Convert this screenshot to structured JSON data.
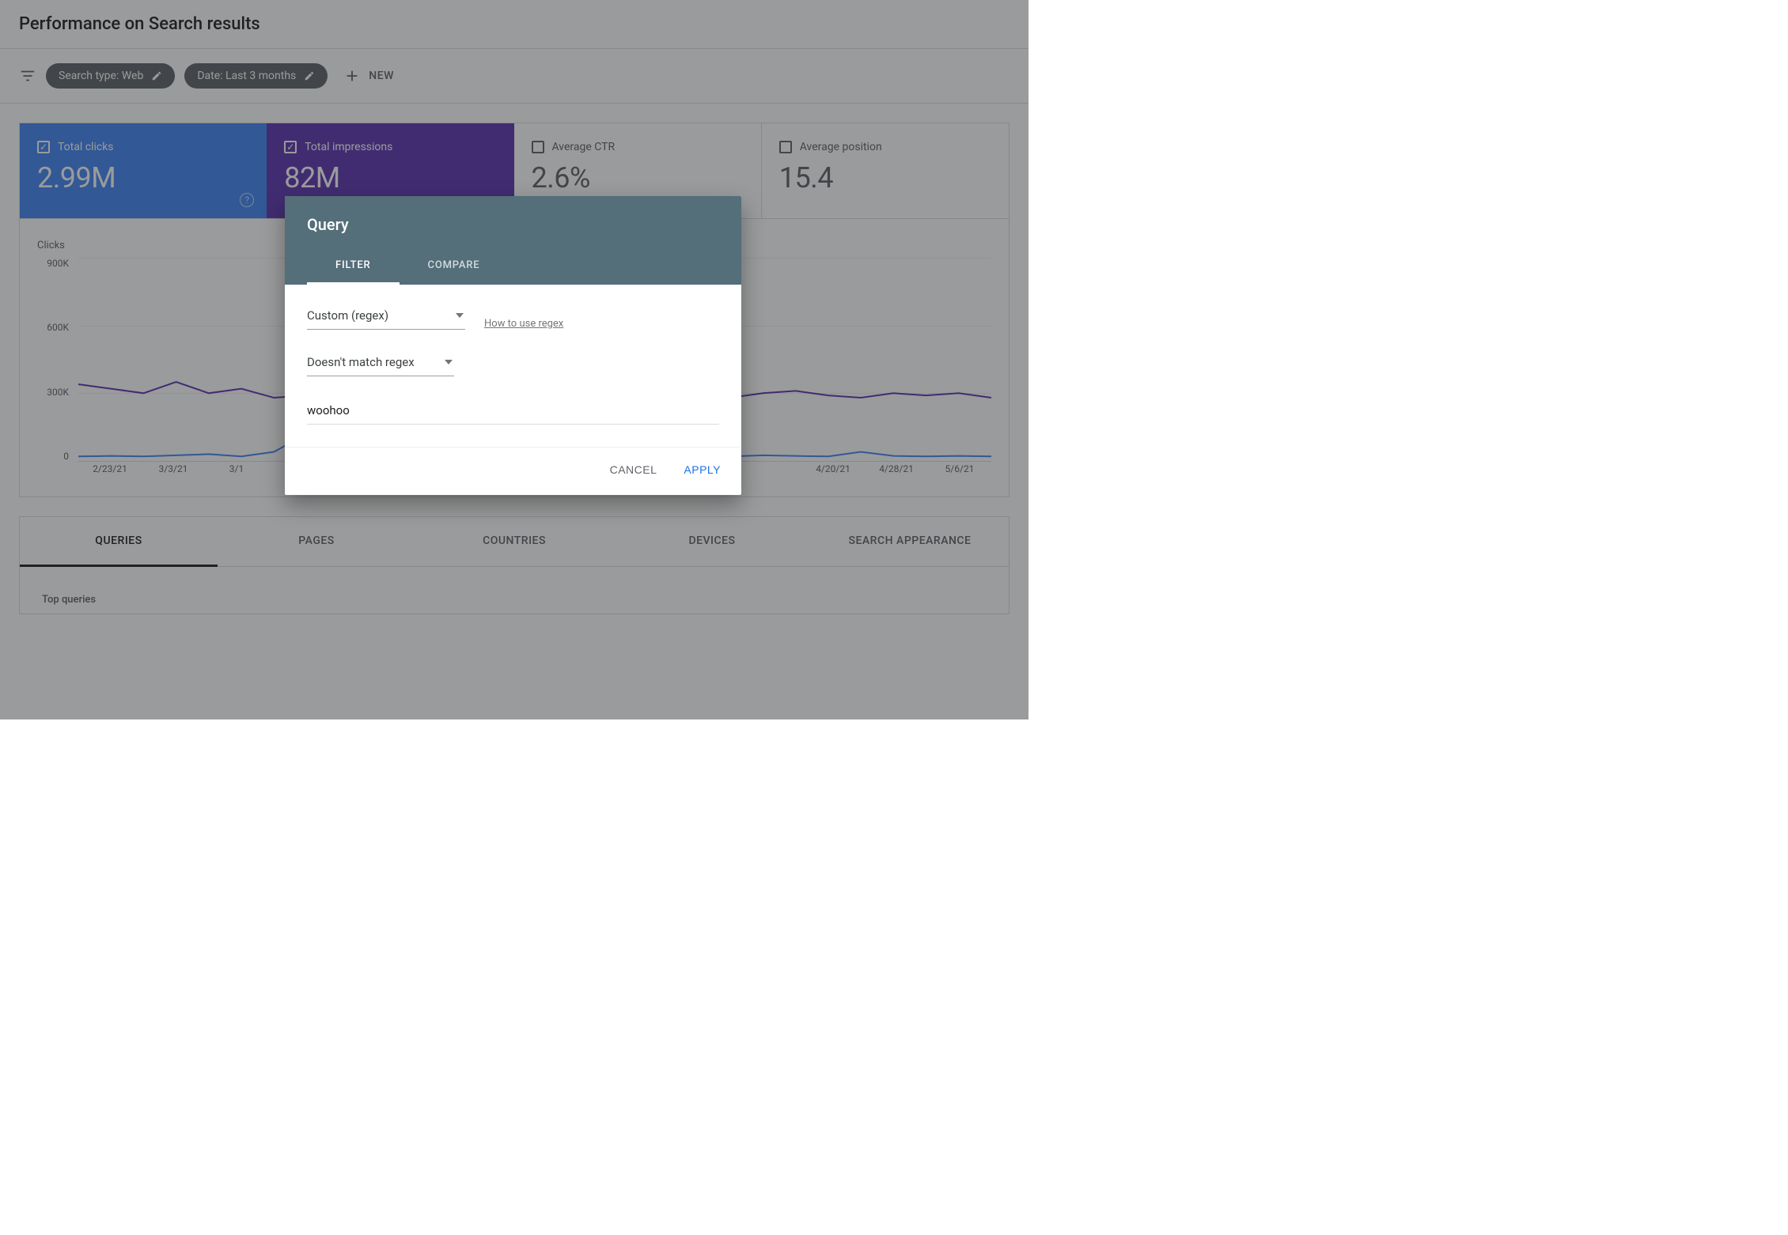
{
  "header": {
    "title": "Performance on Search results"
  },
  "filter_bar": {
    "chip_search_type": "Search type: Web",
    "chip_date": "Date: Last 3 months",
    "new_label": "NEW"
  },
  "metrics": {
    "total_clicks": {
      "label": "Total clicks",
      "value": "2.99M"
    },
    "total_impressions": {
      "label": "Total impressions",
      "value": "82M"
    },
    "avg_ctr": {
      "label": "Average CTR",
      "value": "2.6%"
    },
    "avg_position": {
      "label": "Average position",
      "value": "15.4"
    }
  },
  "chart_axis_label": "Clicks",
  "chart_data": {
    "type": "line",
    "xlabel": "",
    "ylabel": "Clicks",
    "ylim": [
      0,
      900000
    ],
    "y_ticks": [
      "900K",
      "600K",
      "300K",
      "0"
    ],
    "x_ticks": [
      "2/23/21",
      "3/3/21",
      "3/1",
      "4/20/21",
      "4/28/21",
      "5/6/21"
    ],
    "series": [
      {
        "name": "Total impressions",
        "color": "#5e35b1",
        "values": [
          340000,
          320000,
          300000,
          350000,
          300000,
          320000,
          280000,
          290000,
          410000,
          490000,
          330000,
          300000,
          280000,
          260000,
          250000,
          260000,
          300000,
          310000,
          300000,
          290000,
          280000,
          300000,
          310000,
          290000,
          280000,
          300000,
          290000,
          300000,
          280000
        ]
      },
      {
        "name": "Total clicks",
        "color": "#4285f4",
        "values": [
          20000,
          22000,
          20000,
          25000,
          30000,
          20000,
          40000,
          120000,
          25000,
          22000,
          20000,
          22000,
          20000,
          18000,
          20000,
          22000,
          20000,
          25000,
          20000,
          22000,
          20000,
          25000,
          22000,
          20000,
          40000,
          22000,
          20000,
          22000,
          20000
        ]
      }
    ]
  },
  "data_tabs": {
    "tabs": [
      "QUERIES",
      "PAGES",
      "COUNTRIES",
      "DEVICES",
      "SEARCH APPEARANCE"
    ],
    "active": 0,
    "top_queries_label": "Top queries"
  },
  "dialog": {
    "title": "Query",
    "tabs": {
      "filter": "FILTER",
      "compare": "COMPARE"
    },
    "select_mode": "Custom (regex)",
    "help_link": "How to use regex",
    "select_match": "Doesn't match regex",
    "input_value": "woohoo",
    "actions": {
      "cancel": "CANCEL",
      "apply": "APPLY"
    }
  }
}
